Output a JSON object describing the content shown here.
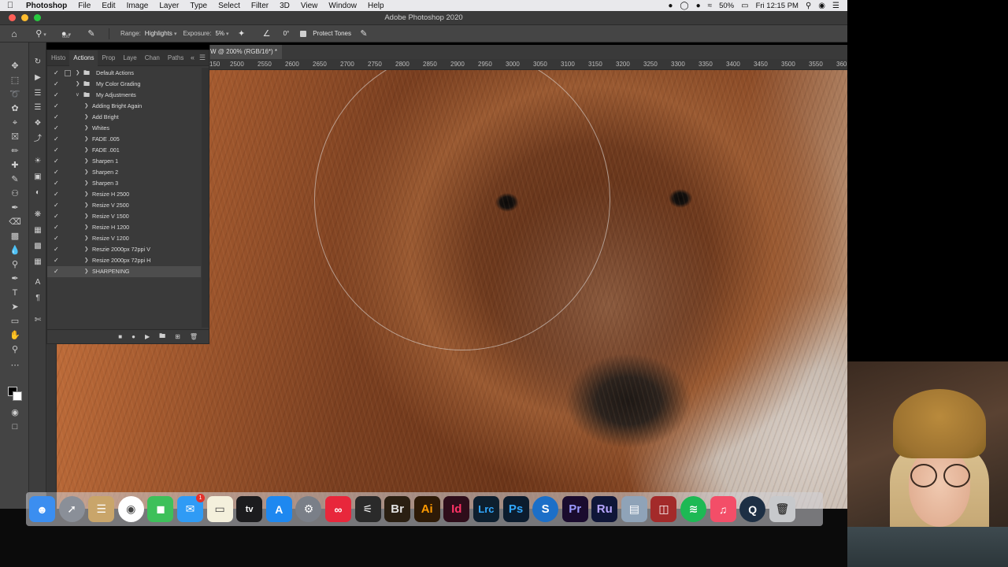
{
  "menubar": {
    "app": "Photoshop",
    "items": [
      "File",
      "Edit",
      "Image",
      "Layer",
      "Type",
      "Select",
      "Filter",
      "3D",
      "View",
      "Window",
      "Help"
    ],
    "battery": "50%",
    "clock": "Fri 12:15 PM"
  },
  "window": {
    "title": "Adobe Photoshop 2020"
  },
  "options": {
    "brush_size": "600",
    "range_label": "Range:",
    "range_value": "Highlights",
    "exposure_label": "Exposure:",
    "exposure_value": "5%",
    "angle_value": "0°",
    "protect_tones": "Protect Tones"
  },
  "document": {
    "tab": "W @ 200% (RGB/16*) *"
  },
  "ruler": {
    "horizontal": [
      "150",
      "2500",
      "2550",
      "2600",
      "2650",
      "2700",
      "2750",
      "2800",
      "2850",
      "2900",
      "2950",
      "3000",
      "3050",
      "3100",
      "3150",
      "3200",
      "3250",
      "3300",
      "3350",
      "3400",
      "3450",
      "3500",
      "3550",
      "360"
    ]
  },
  "panel": {
    "tabs": [
      "Histo",
      "Actions",
      "Prop",
      "Laye",
      "Chan",
      "Paths"
    ],
    "active_tab": "Actions",
    "sets": [
      {
        "label": "Default Actions",
        "level": 0,
        "open": false
      },
      {
        "label": "My Color Grading",
        "level": 0,
        "open": false
      },
      {
        "label": "My Adjustments",
        "level": 0,
        "open": true
      }
    ],
    "actions": [
      "Adding Bright Again",
      "Add Bright",
      "Whites",
      "FADE .005",
      "FADE .001",
      "Sharpen 1",
      "Sharpen 2",
      "Sharpen 3",
      "Resize H 2500",
      "Resize V 2500",
      "Resize V 1500",
      "Resize H 1200",
      "Resize V 1200",
      "Reszie 2000px 72ppi V",
      "Resize 2000px 72ppi H",
      "SHARPENING"
    ],
    "selected": "SHARPENING"
  },
  "dock": {
    "apps": [
      {
        "name": "finder",
        "label": "",
        "bg": "#3b8ef0"
      },
      {
        "name": "launchpad",
        "label": "",
        "bg": "#8a8f98"
      },
      {
        "name": "notes",
        "label": "",
        "bg": "#c9a56a"
      },
      {
        "name": "chrome",
        "label": "",
        "bg": "#ffffff"
      },
      {
        "name": "facetime",
        "label": "",
        "bg": "#3dc05a"
      },
      {
        "name": "messages",
        "label": "",
        "bg": "#2f9bf5",
        "badge": "1"
      },
      {
        "name": "stickies",
        "label": "",
        "bg": "#f4f0dc"
      },
      {
        "name": "appletv",
        "label": "tv",
        "bg": "#1c1c1e"
      },
      {
        "name": "appstore",
        "label": "",
        "bg": "#1e88f0"
      },
      {
        "name": "system-preferences",
        "label": "",
        "bg": "#7a7f88"
      },
      {
        "name": "creative-cloud",
        "label": "",
        "bg": "#e8273b"
      },
      {
        "name": "acrobat",
        "label": "",
        "bg": "#2a2a2a"
      },
      {
        "name": "bridge",
        "label": "Br",
        "bg": "#2a1f12"
      },
      {
        "name": "illustrator",
        "label": "Ai",
        "bg": "#2d1a07"
      },
      {
        "name": "indesign",
        "label": "Id",
        "bg": "#2e0d1a"
      },
      {
        "name": "lightroom-classic",
        "label": "Lrc",
        "bg": "#0d1f2f"
      },
      {
        "name": "photoshop",
        "label": "Ps",
        "bg": "#0b1c2e"
      },
      {
        "name": "sync",
        "label": "S",
        "bg": "#1c6fc8"
      },
      {
        "name": "premiere",
        "label": "Pr",
        "bg": "#1a0b2e"
      },
      {
        "name": "rush",
        "label": "Ru",
        "bg": "#0f1638"
      },
      {
        "name": "preview",
        "label": "",
        "bg": "#8fa3b8"
      },
      {
        "name": "photo-booth",
        "label": "",
        "bg": "#a32a2a"
      },
      {
        "name": "spotify",
        "label": "",
        "bg": "#1db954"
      },
      {
        "name": "music",
        "label": "",
        "bg": "#f34e68"
      },
      {
        "name": "quicktime",
        "label": "",
        "bg": "#1d2f44"
      },
      {
        "name": "trash",
        "label": "",
        "bg": "#c7c9cc"
      }
    ]
  }
}
